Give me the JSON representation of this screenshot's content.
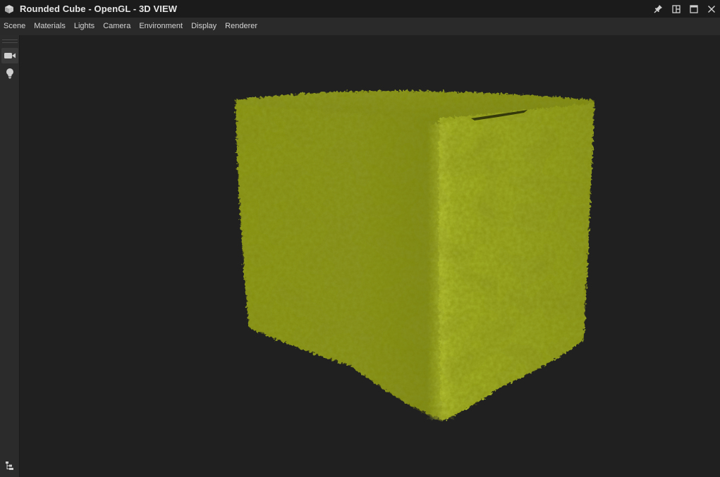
{
  "window": {
    "title": "Rounded Cube - OpenGL - 3D VIEW",
    "icon": "cube-icon",
    "controls": [
      "pin-icon",
      "split-view-icon",
      "maximize-icon",
      "close-icon"
    ]
  },
  "menu": {
    "items": [
      "Scene",
      "Materials",
      "Lights",
      "Camera",
      "Environment",
      "Display",
      "Renderer"
    ]
  },
  "sidebar": {
    "tools": [
      {
        "icon": "camera-icon",
        "active": true
      },
      {
        "icon": "light-bulb-icon",
        "active": false
      }
    ],
    "bottom_tool": {
      "icon": "scene-tree-icon"
    }
  },
  "viewport": {
    "object": "rounded-cube",
    "material_color": "#9aa826",
    "background": "#202020"
  }
}
